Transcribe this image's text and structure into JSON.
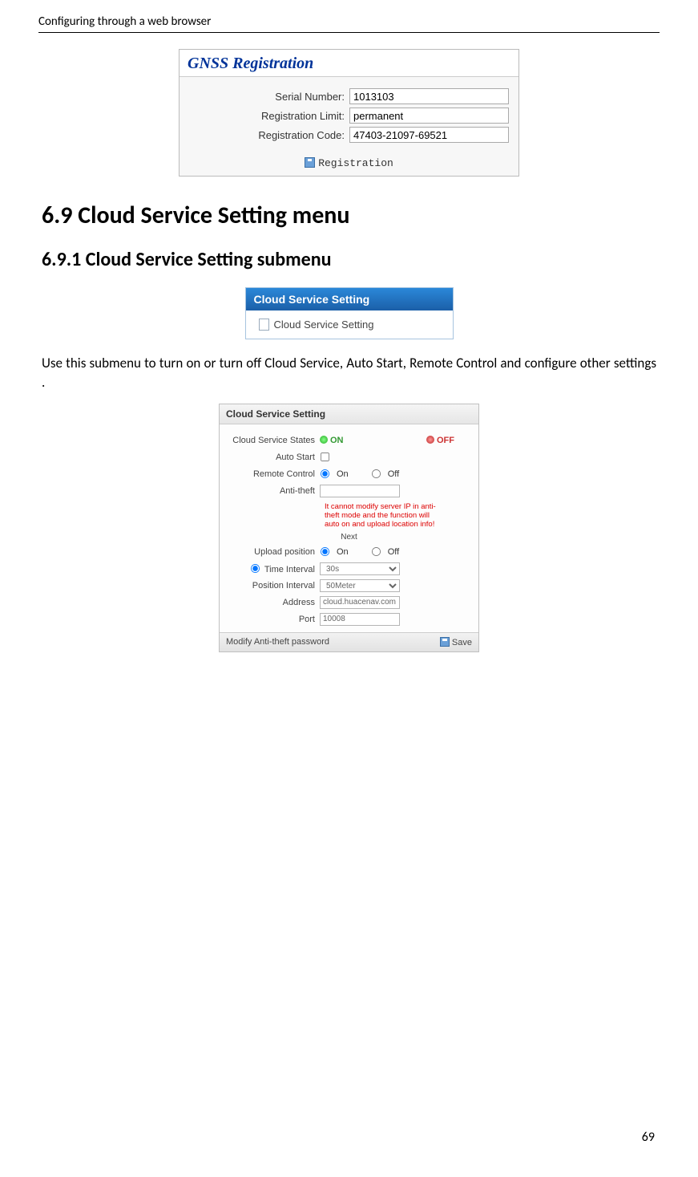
{
  "header": "Configuring through a web browser",
  "page_number": "69",
  "gnss": {
    "title": "GNSS Registration",
    "serial_label": "Serial Number:",
    "serial_value": "1013103",
    "limit_label": "Registration Limit:",
    "limit_value": "permanent",
    "code_label": "Registration Code:",
    "code_value": "47403-21097-69521",
    "button": "Registration"
  },
  "h1": "6.9  Cloud Service Setting menu",
  "h2": "6.9.1  Cloud Service Setting submenu",
  "menu": {
    "header": "Cloud Service Setting",
    "item": "Cloud Service Setting"
  },
  "para": "Use this submenu to turn on or turn off Cloud Service, Auto Start, Remote Control and configure other settings .",
  "form": {
    "title": "Cloud Service Setting",
    "states_label": "Cloud Service States",
    "on": "ON",
    "off": "OFF",
    "auto_start": "Auto Start",
    "remote_control": "Remote Control",
    "rc_on": "On",
    "rc_off": "Off",
    "anti_theft": "Anti-theft",
    "anti_theft_value": "",
    "warning": "It cannot modify server IP in anti-theft mode and the function will auto on and upload location info!",
    "next": "Next",
    "upload_position": "Upload position",
    "up_on": "On",
    "up_off": "Off",
    "time_interval": "Time Interval",
    "time_value": "30s",
    "position_interval": "Position Interval",
    "position_value": "50Meter",
    "address": "Address",
    "address_value": "cloud.huacenav.com",
    "port": "Port",
    "port_value": "10008",
    "modify_pw": "Modify Anti-theft password",
    "save": "Save"
  }
}
